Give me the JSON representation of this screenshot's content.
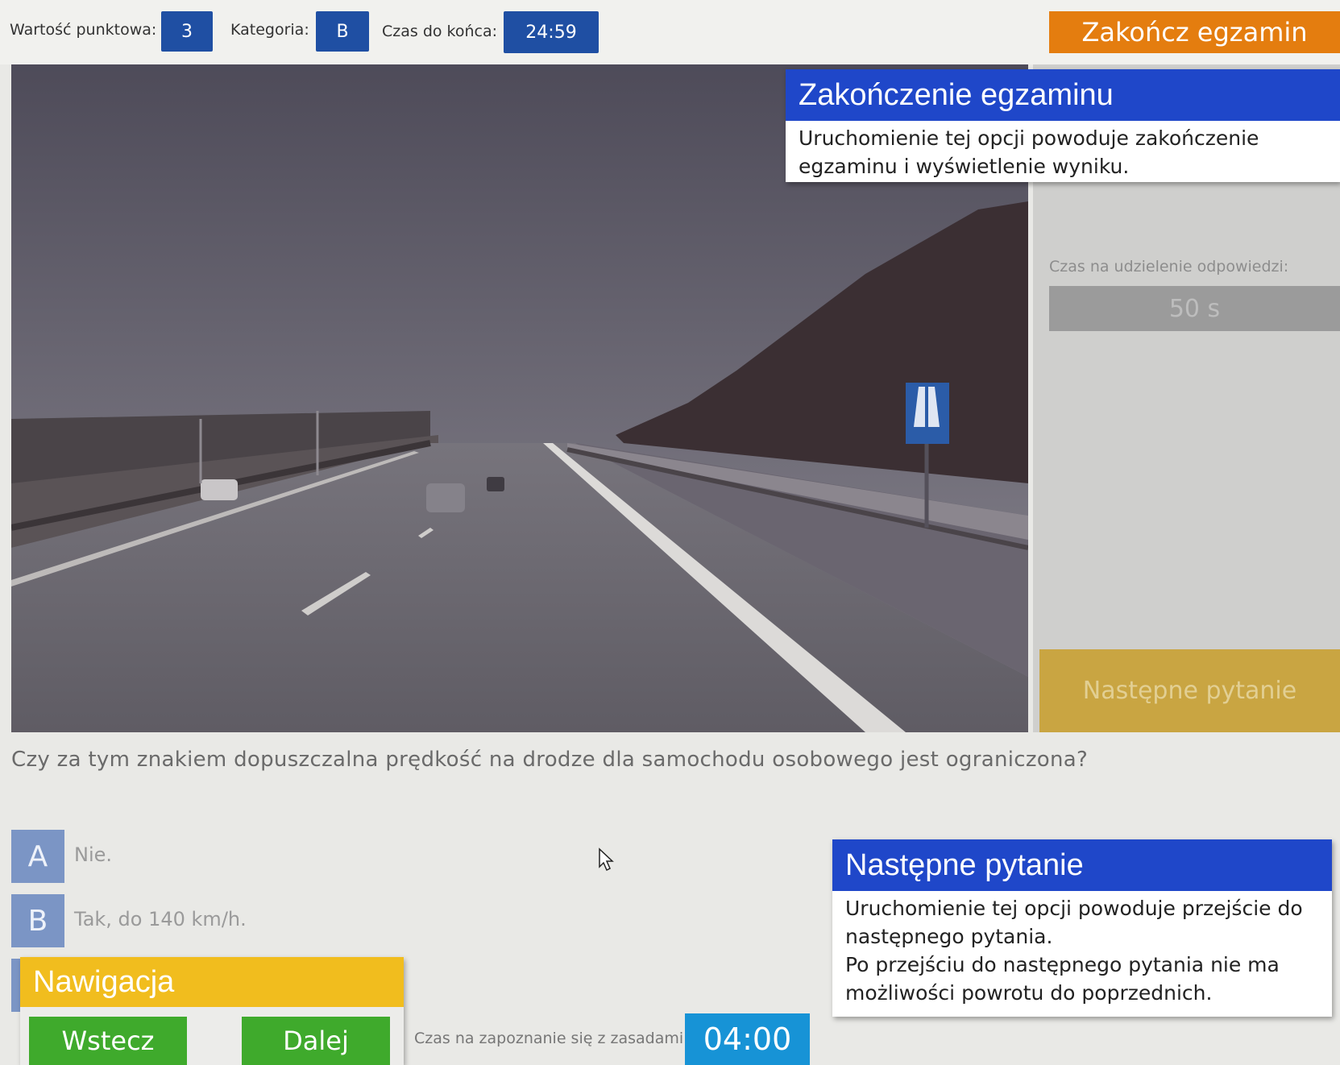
{
  "topbar": {
    "points_label": "Wartość punktowa:",
    "points_value": "3",
    "category_label": "Kategoria:",
    "category_value": "B",
    "time_label": "Czas do końca:",
    "time_value": "24:59",
    "end_button": "Zakończ egzamin"
  },
  "side": {
    "answer_time_label": "Czas na udzielenie odpowiedzi:",
    "answer_time_value": "50 s",
    "next_button": "Następne pytanie"
  },
  "question": "Czy za tym znakiem dopuszczalna prędkość na drodze dla samochodu osobowego jest ograniczona?",
  "answers": [
    {
      "letter": "A",
      "text": "Nie."
    },
    {
      "letter": "B",
      "text": "Tak, do 140 km/h."
    }
  ],
  "tooltips": {
    "end": {
      "title": "Zakończenie egzaminu",
      "line1": "Uruchomienie tej opcji powoduje zakończenie",
      "line2": "egzaminu i wyświetlenie wyniku."
    },
    "next": {
      "title": "Następne pytanie",
      "line1": "Uruchomienie tej opcji powoduje przejście do",
      "line2": "następnego pytania.",
      "line3": "Po przejściu do następnego pytania nie ma",
      "line4": "możliwości powrotu do poprzednich."
    },
    "nav": {
      "title": "Nawigacja",
      "back": "Wstecz",
      "forward": "Dalej"
    }
  },
  "footer": {
    "rules_label": "Czas na zapoznanie się z zasadami:",
    "rules_time": "04:00"
  },
  "colors": {
    "badge_blue": "#1f4fa3",
    "end_orange": "#e47d0f",
    "tooltip_blue": "#1f47c9",
    "nav_yellow": "#f1bd1e",
    "nav_green": "#3faa2c",
    "timer_blue": "#1793d6"
  },
  "icons": [
    "mouse-cursor-icon",
    "motorway-sign-icon"
  ]
}
